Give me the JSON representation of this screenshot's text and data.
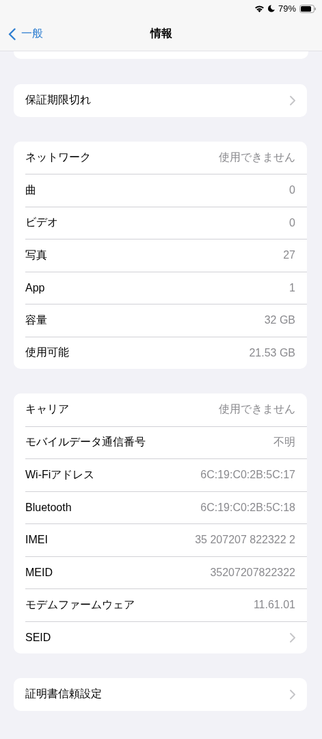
{
  "status_bar": {
    "battery_text": "79%"
  },
  "nav": {
    "back_label": "一般",
    "title": "情報"
  },
  "sections": [
    {
      "rows": [
        {
          "kind": "link",
          "label": "保証期限切れ"
        }
      ]
    },
    {
      "rows": [
        {
          "kind": "value",
          "label": "ネットワーク",
          "value": "使用できません"
        },
        {
          "kind": "value",
          "label": "曲",
          "value": "0"
        },
        {
          "kind": "value",
          "label": "ビデオ",
          "value": "0"
        },
        {
          "kind": "value",
          "label": "写真",
          "value": "27"
        },
        {
          "kind": "value",
          "label": "App",
          "value": "1"
        },
        {
          "kind": "value",
          "label": "容量",
          "value": "32 GB"
        },
        {
          "kind": "value",
          "label": "使用可能",
          "value": "21.53 GB"
        }
      ]
    },
    {
      "rows": [
        {
          "kind": "value",
          "label": "キャリア",
          "value": "使用できません"
        },
        {
          "kind": "value",
          "label": "モバイルデータ通信番号",
          "value": "不明"
        },
        {
          "kind": "value",
          "label": "Wi-Fiアドレス",
          "value": "6C:19:C0:2B:5C:17"
        },
        {
          "kind": "value",
          "label": "Bluetooth",
          "value": "6C:19:C0:2B:5C:18"
        },
        {
          "kind": "value",
          "label": "IMEI",
          "value": "35 207207 822322 2"
        },
        {
          "kind": "value",
          "label": "MEID",
          "value": "35207207822322"
        },
        {
          "kind": "value",
          "label": "モデムファームウェア",
          "value": "11.61.01"
        },
        {
          "kind": "link",
          "label": "SEID"
        }
      ]
    },
    {
      "rows": [
        {
          "kind": "link",
          "label": "証明書信頼設定"
        }
      ]
    }
  ]
}
